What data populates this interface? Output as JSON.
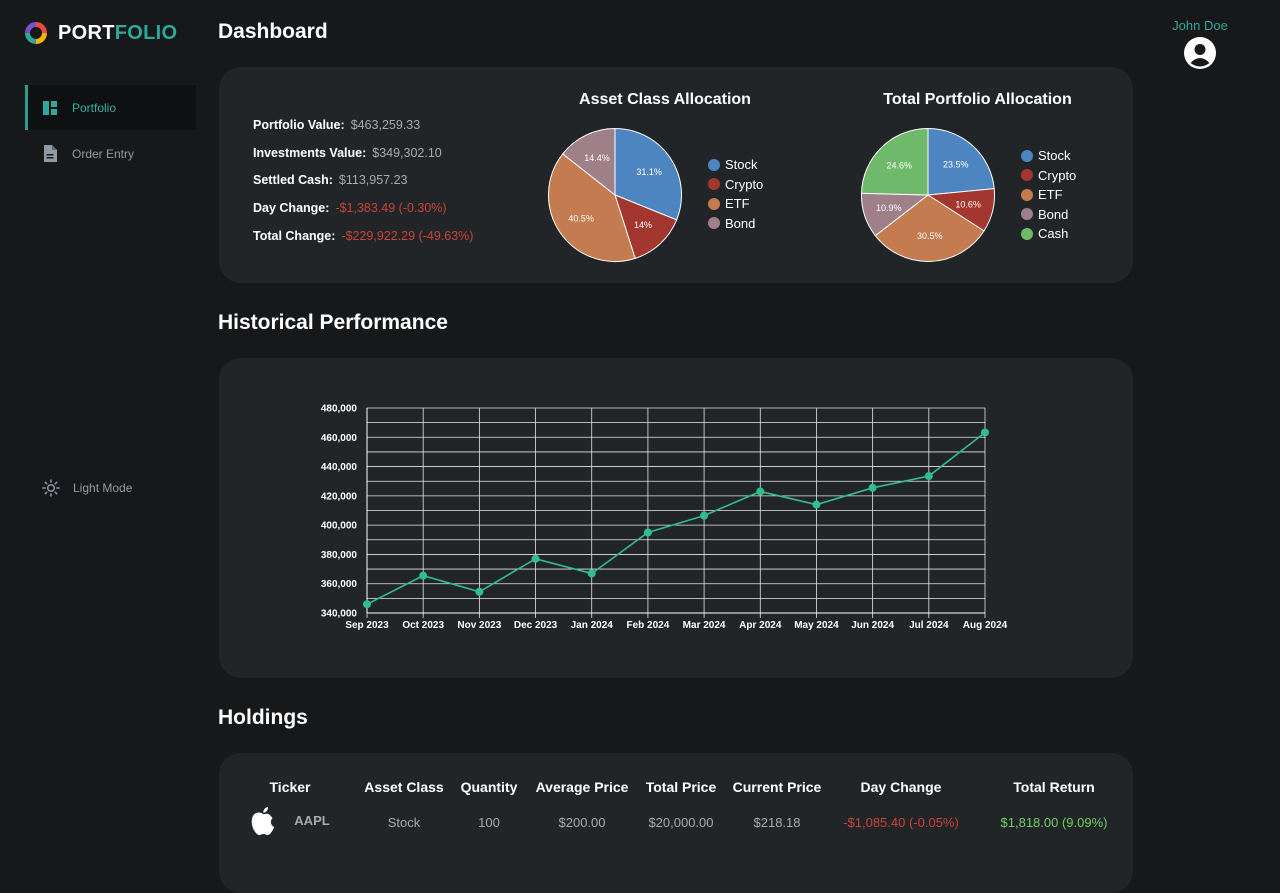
{
  "app": {
    "logo_part1": "PORT",
    "logo_part2": "FOLIO",
    "user_name": "John Doe"
  },
  "sidebar": {
    "items": [
      {
        "label": "Portfolio",
        "icon": "dashboard-icon",
        "active": true
      },
      {
        "label": "Order Entry",
        "icon": "document-icon",
        "active": false
      }
    ],
    "theme_toggle": {
      "label": "Light Mode",
      "icon": "sun-icon"
    }
  },
  "sections": {
    "dashboard": "Dashboard",
    "history": "Historical Performance",
    "holdings": "Holdings"
  },
  "summary": [
    {
      "label": "Portfolio Value:",
      "value": "$463,259.33",
      "negative": false
    },
    {
      "label": "Investments Value:",
      "value": "$349,302.10",
      "negative": false
    },
    {
      "label": "Settled Cash:",
      "value": "$113,957.23",
      "negative": false
    },
    {
      "label": "Day Change:",
      "value": "-$1,383.49 (-0.30%)",
      "negative": true
    },
    {
      "label": "Total Change:",
      "value": "-$229,922.29 (-49.63%)",
      "negative": true
    }
  ],
  "colors": {
    "accent": "#2ea89a",
    "stock": "#4d85c1",
    "crypto": "#a3372f",
    "etf": "#c57b50",
    "bond": "#a08088",
    "cash": "#6fba6a",
    "line": "#2fbf8a",
    "negative": "#c9443a",
    "positive": "#6fcf63"
  },
  "chart_data": [
    {
      "type": "pie",
      "title": "Asset Class Allocation",
      "categories": [
        "Stock",
        "Crypto",
        "ETF",
        "Bond"
      ],
      "values": [
        31.1,
        14,
        40.5,
        14.4
      ],
      "labels": [
        "31.1%",
        "14%",
        "40.5%",
        "14.4%"
      ]
    },
    {
      "type": "pie",
      "title": "Total Portfolio Allocation",
      "categories": [
        "Stock",
        "Crypto",
        "ETF",
        "Bond",
        "Cash"
      ],
      "values": [
        23.5,
        10.6,
        30.5,
        10.9,
        24.6
      ],
      "labels": [
        "23.5%",
        "10.6%",
        "30.5%",
        "10.9%",
        "24.6%"
      ]
    },
    {
      "type": "line",
      "title": "",
      "x": [
        "Sep 2023",
        "Oct 2023",
        "Nov 2023",
        "Dec 2023",
        "Jan 2024",
        "Feb 2024",
        "Mar 2024",
        "Apr 2024",
        "May 2024",
        "Jun 2024",
        "Jul 2024",
        "Aug 2024"
      ],
      "series": [
        {
          "values": [
            346000,
            365500,
            354500,
            377000,
            367000,
            395000,
            406500,
            423000,
            414000,
            425500,
            433500,
            463300
          ]
        }
      ],
      "ylim": [
        340000,
        480000
      ],
      "yticks": [
        "340,000",
        "360,000",
        "380,000",
        "400,000",
        "420,000",
        "440,000",
        "460,000",
        "480,000"
      ],
      "grid": true
    }
  ],
  "holdings": {
    "columns": [
      "Ticker",
      "Asset Class",
      "Quantity",
      "Average Price",
      "Total Price",
      "Current Price",
      "Day Change",
      "Total Return"
    ],
    "rows": [
      {
        "ticker": "AAPL",
        "icon": "apple-logo-icon",
        "asset_class": "Stock",
        "quantity": "100",
        "average_price": "$200.00",
        "total_price": "$20,000.00",
        "current_price": "$218.18",
        "day_change": "-$1,085.40 (-0.05%)",
        "total_return": "$1,818.00 (9.09%)"
      }
    ]
  }
}
